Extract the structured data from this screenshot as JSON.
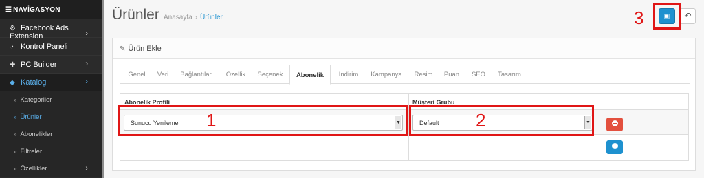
{
  "sidebar": {
    "header": "NAVİGASYON",
    "items": [
      {
        "label": "Facebook Ads Extension",
        "icon": "gear-group-icon"
      },
      {
        "label": "Kontrol Paneli",
        "icon": "dashboard-icon"
      },
      {
        "label": "PC Builder",
        "icon": "puzzle-icon"
      },
      {
        "label": "Katalog",
        "icon": "tag-icon"
      }
    ],
    "subitems": [
      {
        "label": "Kategoriler"
      },
      {
        "label": "Ürünler"
      },
      {
        "label": "Abonelikler"
      },
      {
        "label": "Filtreler"
      },
      {
        "label": "Özellikler"
      }
    ]
  },
  "header": {
    "title": "Ürünler",
    "breadcrumb": [
      "Anasayfa",
      "Ürünler"
    ]
  },
  "panel": {
    "title": "Ürün Ekle"
  },
  "tabs": [
    "Genel",
    "Veri",
    "Bağlantılar",
    "Özellik",
    "Seçenek",
    "Abonelik",
    "İndirim",
    "Kampanya",
    "Resim",
    "Puan",
    "SEO",
    "Tasarım"
  ],
  "active_tab": "Abonelik",
  "subscription_table": {
    "columns": [
      "Abonelik Profili",
      "Müşteri Grubu"
    ],
    "row": {
      "profile": "Sunucu Yenileme",
      "customer_group": "Default"
    }
  },
  "annotations": [
    "1",
    "2",
    "3"
  ],
  "colors": {
    "accent": "#1e91cf",
    "danger": "#e3503e",
    "annotation": "#e01616",
    "sidebar": "#2b2b2b"
  }
}
